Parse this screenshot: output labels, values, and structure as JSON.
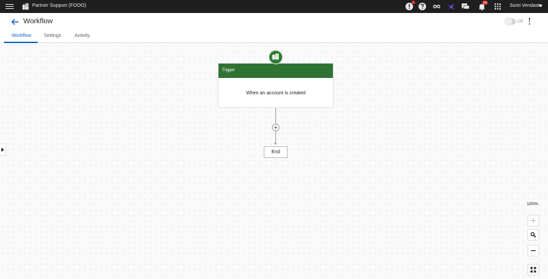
{
  "topbar": {
    "org_name": "Partner Support (FOOO)",
    "notifications_count": "10",
    "user_name": "Sumi Vendasta"
  },
  "header": {
    "title": "Workflow",
    "toggle_label": "Off"
  },
  "tabs": [
    {
      "label": "Workflow",
      "active": true
    },
    {
      "label": "Settings",
      "active": false
    },
    {
      "label": "Activity",
      "active": false
    }
  ],
  "workflow": {
    "trigger_title": "Trigger",
    "trigger_description": "When an account is created",
    "end_label": "End"
  },
  "zoom": {
    "level": "100%"
  },
  "colors": {
    "topbar": "#1f1f1f",
    "accent": "#1565c0",
    "trigger_green": "#2e7332",
    "badge_red": "#e53935",
    "agent_purple": "#7c4dff"
  }
}
